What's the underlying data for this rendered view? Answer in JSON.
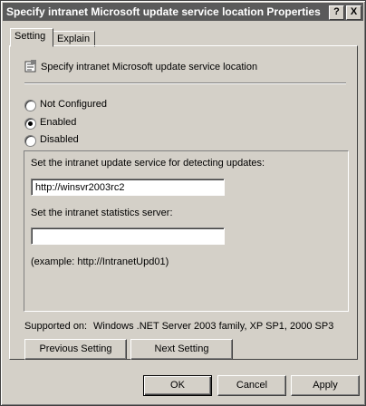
{
  "window": {
    "title": "Specify intranet Microsoft update service location Properties"
  },
  "titlebar": {
    "help_label": "?",
    "close_label": "X"
  },
  "tabs": [
    {
      "label": "Setting"
    },
    {
      "label": "Explain"
    }
  ],
  "policy": {
    "name": "Specify intranet Microsoft update service location",
    "icon": "policy-setting-icon"
  },
  "options": [
    {
      "label": "Not Configured",
      "selected": false
    },
    {
      "label": "Enabled",
      "selected": true
    },
    {
      "label": "Disabled",
      "selected": false
    }
  ],
  "settings": {
    "update_label": "Set the intranet update service for detecting updates:",
    "update_value": "http://winsvr2003rc2",
    "stats_label": "Set the intranet statistics server:",
    "stats_value": "",
    "example": "(example: http://IntranetUpd01)"
  },
  "supported": {
    "label": "Supported on:",
    "value": "Windows .NET Server 2003 family, XP SP1, 2000 SP3"
  },
  "nav": {
    "previous": "Previous Setting",
    "next": "Next Setting"
  },
  "footer": {
    "ok": "OK",
    "cancel": "Cancel",
    "apply": "Apply"
  },
  "colors": {
    "titlebar": "#5a5a5a",
    "face": "#d4d0c8"
  }
}
